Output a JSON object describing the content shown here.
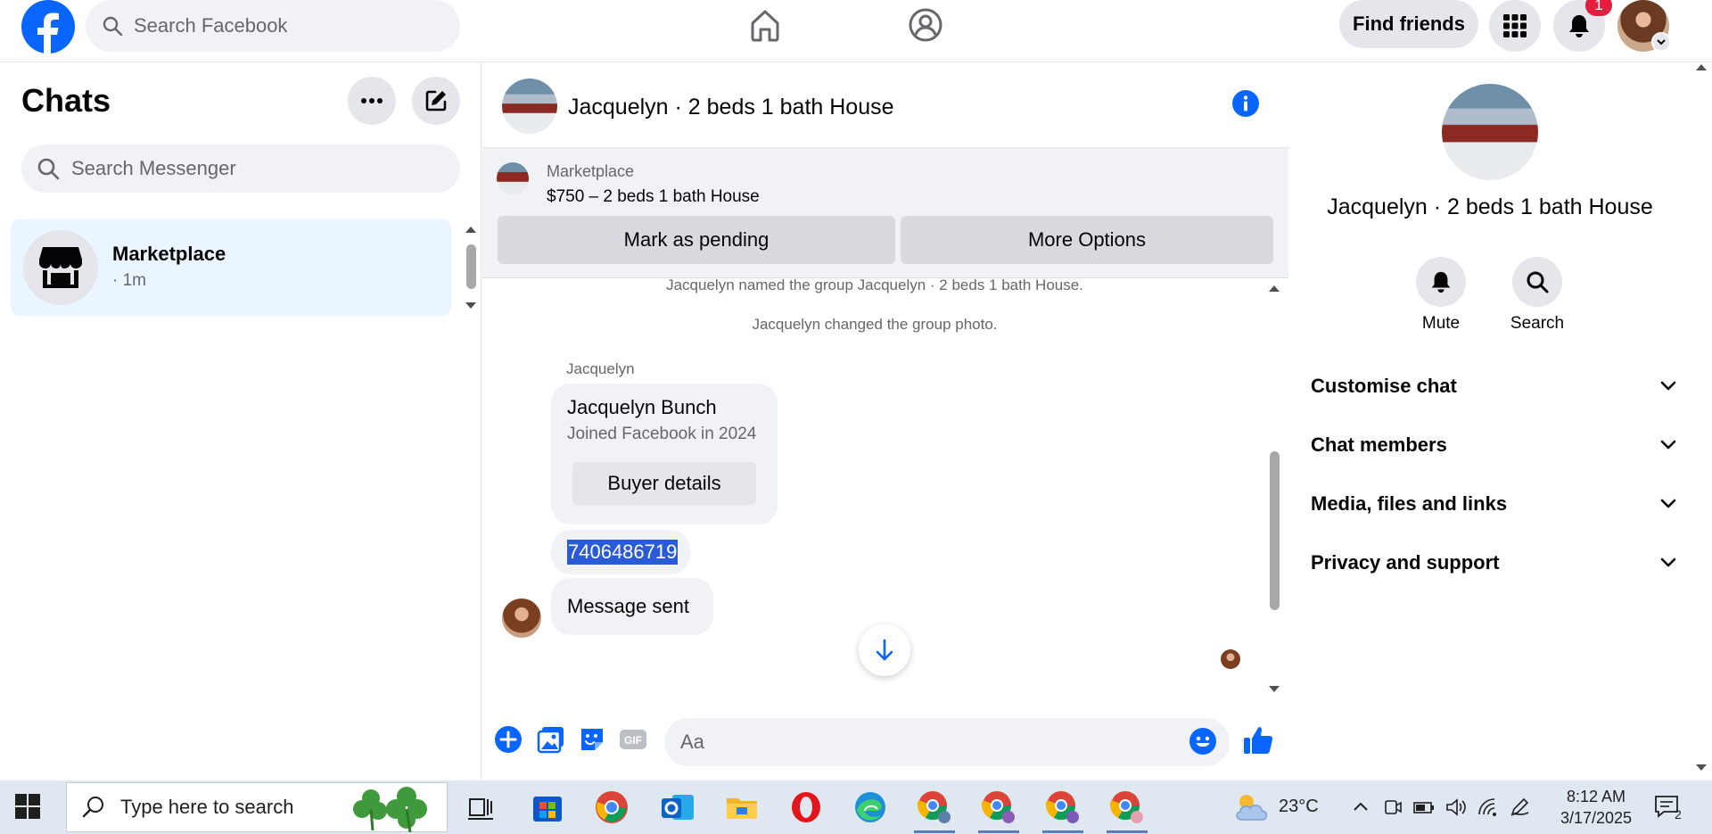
{
  "topbar": {
    "search_placeholder": "Search Facebook",
    "find_friends_label": "Find friends",
    "notification_count": "1"
  },
  "left": {
    "title": "Chats",
    "search_placeholder": "Search Messenger",
    "chats": [
      {
        "name": "Marketplace",
        "time": "· 1m"
      }
    ]
  },
  "conversation": {
    "title": "Jacquelyn · 2 beds 1 bath House",
    "marketplace": {
      "label": "Marketplace",
      "listing": "$750 – 2 beds 1 bath House",
      "pending_button": "Mark as pending",
      "options_button": "More Options"
    },
    "system_messages": [
      "Jacquelyn named the group Jacquelyn · 2 beds 1 bath House.",
      "Jacquelyn changed the group photo."
    ],
    "sender": "Jacquelyn",
    "card": {
      "name": "Jacquelyn Bunch",
      "subtitle": "Joined Facebook in 2024",
      "button": "Buyer details"
    },
    "phone_message": "7406486719",
    "sent_message": "Message sent",
    "composer_placeholder": "Aa"
  },
  "details": {
    "title": "Jacquelyn · 2 beds 1 bath House",
    "actions": [
      {
        "label": "Mute",
        "icon": "bell-icon"
      },
      {
        "label": "Search",
        "icon": "search-icon"
      }
    ],
    "sections": [
      "Customise chat",
      "Chat members",
      "Media, files and links",
      "Privacy and support"
    ]
  },
  "taskbar": {
    "search_placeholder": "Type here to search",
    "temperature": "23°C",
    "time": "8:12 AM",
    "date": "3/17/2025",
    "notification_count": "2"
  },
  "colors": {
    "facebook_blue": "#0866ff",
    "selected_chat_bg": "#ebf5ff",
    "bubble_bg": "#f0f2f5",
    "badge_red": "#e41e3f"
  }
}
